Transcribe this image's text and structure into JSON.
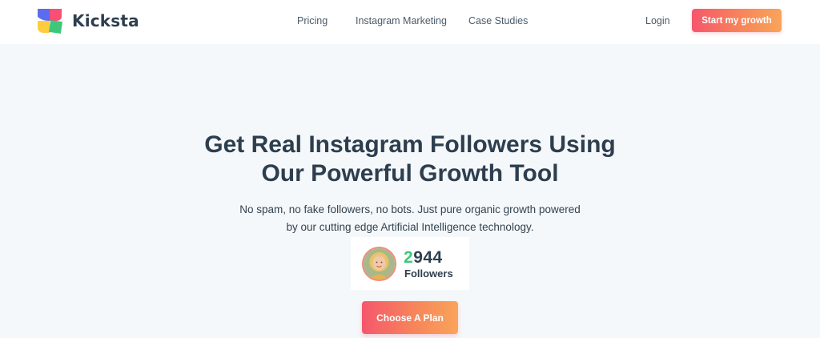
{
  "brand": {
    "name": "Kicksta"
  },
  "nav": {
    "pricing": "Pricing",
    "instagram_marketing": "Instagram Marketing",
    "case_studies": "Case Studies",
    "login": "Login",
    "cta": "Start my growth"
  },
  "hero": {
    "title_line1": "Get Real Instagram Followers Using",
    "title_line2": "Our Powerful Growth Tool",
    "subtitle_line1": "No spam, no fake followers, no bots. Just pure organic growth powered",
    "subtitle_line2": "by our cutting edge Artificial Intelligence technology."
  },
  "counter": {
    "first_digit": "2",
    "rest_digits": "944",
    "label": "Followers"
  },
  "cta_main": "Choose A Plan",
  "colors": {
    "accent_start": "#f5576c",
    "accent_end": "#f9a45a",
    "counter_green": "#3ec77a",
    "text_dark": "#2d3e4e",
    "background": "#f5f8fb"
  }
}
